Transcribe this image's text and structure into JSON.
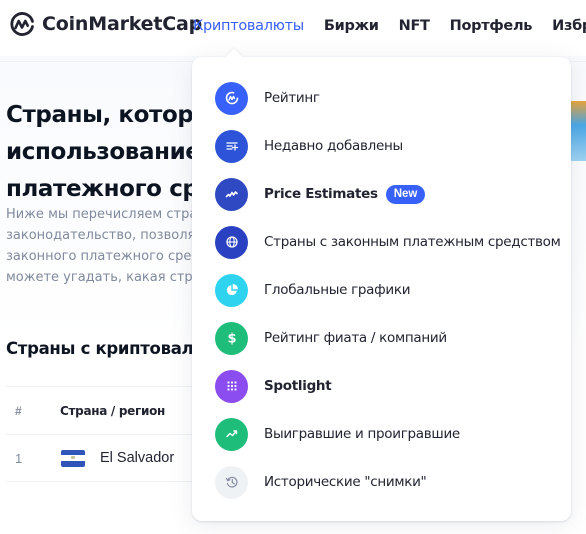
{
  "header": {
    "logo_text": "CoinMarketCap",
    "nav": [
      {
        "label": "Криптовалюты",
        "active": true
      },
      {
        "label": "Биржи"
      },
      {
        "label": "NFT"
      },
      {
        "label": "Портфель"
      },
      {
        "label": "Избранное"
      }
    ]
  },
  "page": {
    "title_lines": [
      "Страны, которы",
      "использование",
      "платежного сре,"
    ],
    "description_lines": [
      "Ниже мы перечисляем стран",
      "законодательство, позволяю",
      "законного платежного средс",
      "можете угадать, какая страна"
    ],
    "section_title": "Страны с криптовалю",
    "table": {
      "headers": {
        "num": "#",
        "country": "Страна / регион"
      },
      "rows": [
        {
          "num": "1",
          "country": "El Salvador",
          "flag": "flag-el-salvador"
        }
      ]
    }
  },
  "dropdown": {
    "items": [
      {
        "label": "Рейтинг",
        "icon": "cmc-logo-icon",
        "color": "#3861fb"
      },
      {
        "label": "Недавно добавлены",
        "icon": "list-add-icon",
        "color": "#2d54d8"
      },
      {
        "label": "Price Estimates",
        "icon": "chart-wave-icon",
        "color": "#2e49c2",
        "badge": "New",
        "bold": true
      },
      {
        "label": "Страны с законным платежным средством",
        "icon": "globe-icon",
        "color": "#2a42c2"
      },
      {
        "label": "Глобальные графики",
        "icon": "pie-chart-icon",
        "color": "#2ed3f0"
      },
      {
        "label": "Рейтинг фиата / компаний",
        "icon": "dollar-icon",
        "color": "#1fbd7a"
      },
      {
        "label": "Spotlight",
        "icon": "grid-icon",
        "color": "#8b4cf0",
        "bold": true
      },
      {
        "label": "Выигравшие и проигравшие",
        "icon": "trending-up-icon",
        "color": "#1fbd7a"
      },
      {
        "label": "Исторические \"снимки\"",
        "icon": "history-icon",
        "color": "#eff2f5"
      }
    ]
  }
}
